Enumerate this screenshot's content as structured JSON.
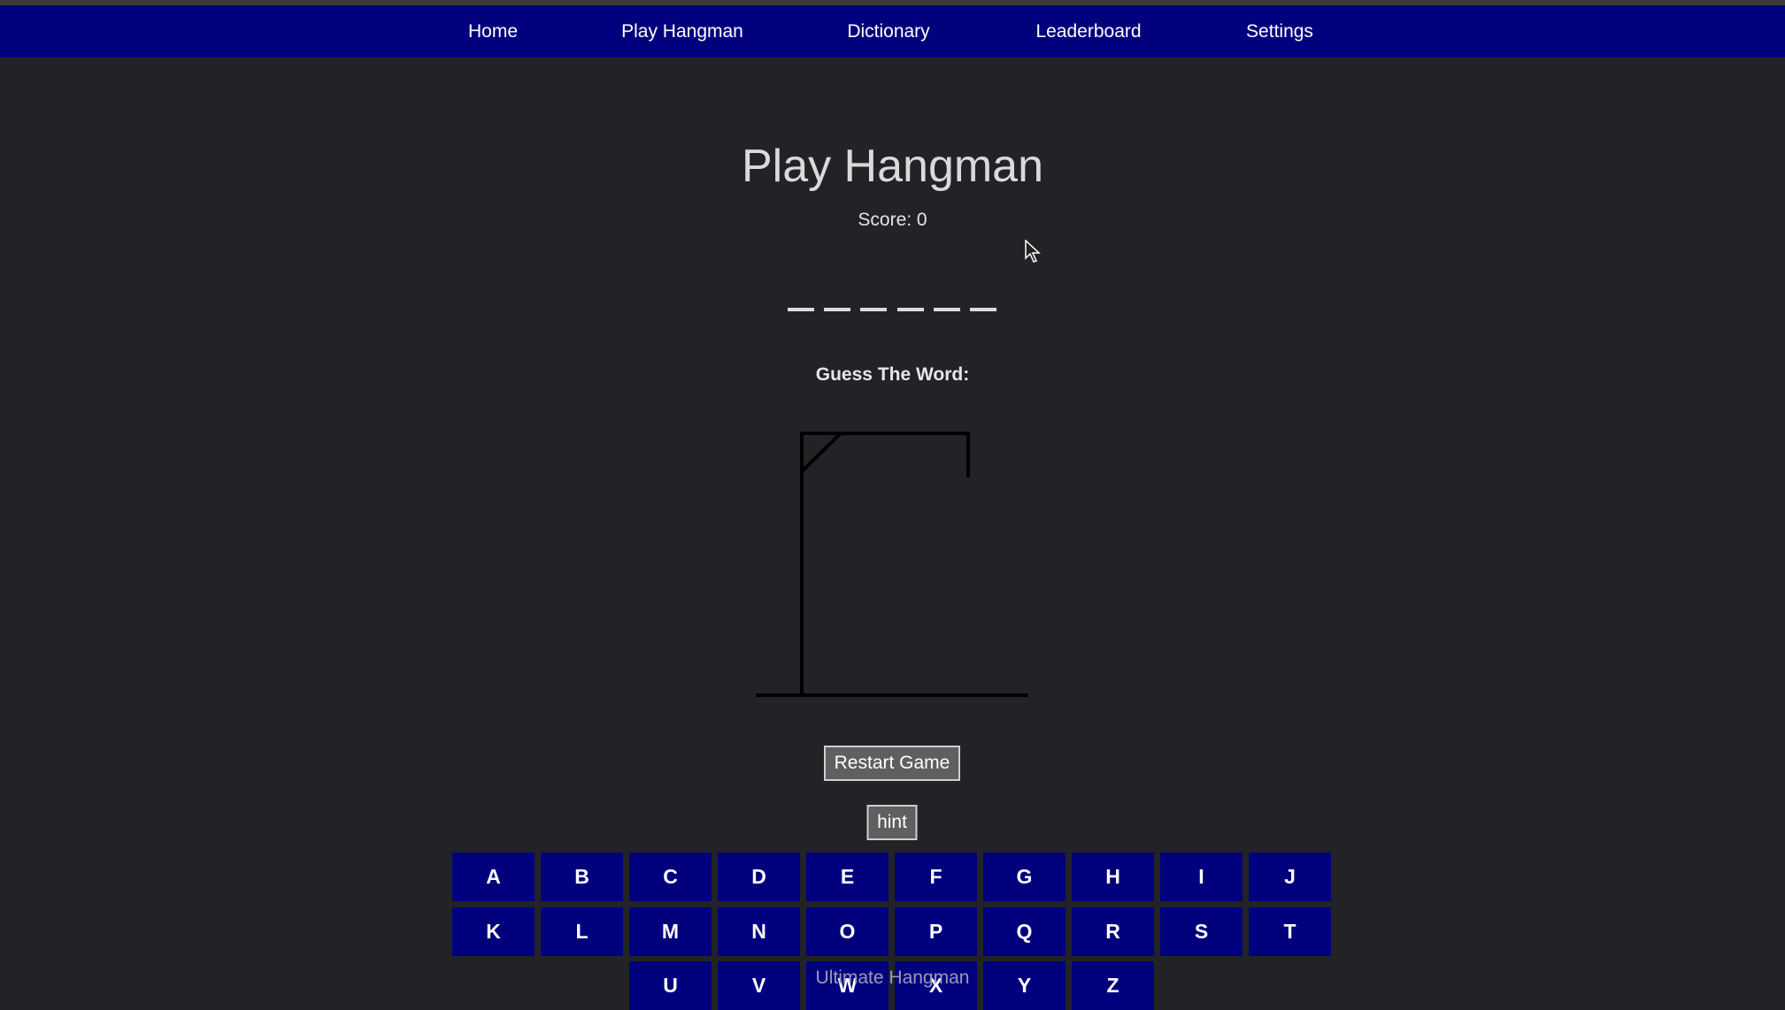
{
  "nav": {
    "home": "Home",
    "play": "Play Hangman",
    "dictionary": "Dictionary",
    "leaderboard": "Leaderboard",
    "settings": "Settings"
  },
  "game": {
    "title": "Play Hangman",
    "score": "Score: 0",
    "word_length": 6,
    "guess_label": "Guess The Word:",
    "wrong_guesses": 0
  },
  "buttons": {
    "restart": "Restart Game",
    "hint": "hint"
  },
  "keyboard": {
    "row1": [
      "A",
      "B",
      "C",
      "D",
      "E",
      "F",
      "G",
      "H",
      "I",
      "J"
    ],
    "row2": [
      "K",
      "L",
      "M",
      "N",
      "O",
      "P",
      "Q",
      "R",
      "S",
      "T"
    ],
    "row3": [
      "U",
      "V",
      "W",
      "X",
      "Y",
      "Z"
    ]
  },
  "footer": {
    "text": "Ultimate Hangman"
  },
  "colors": {
    "background": "#222327",
    "nav_bg": "#01017e",
    "key_bg": "#01017e",
    "button_bg": "#5f5f5f"
  }
}
